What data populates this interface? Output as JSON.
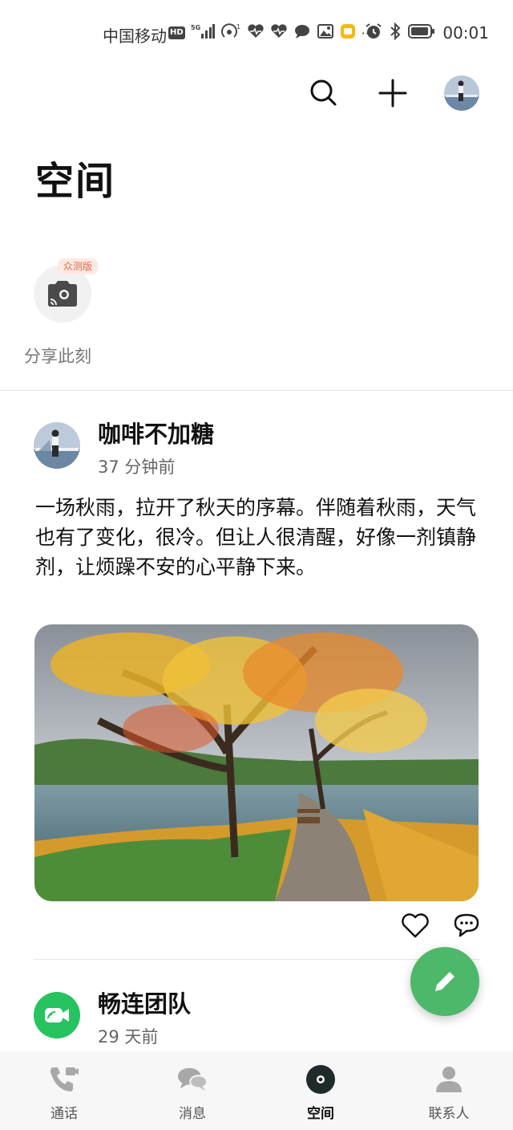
{
  "status_bar": {
    "carrier": "中国移动",
    "hd": "HD",
    "network": "5G",
    "time": "00:01",
    "icons": [
      "signal-icon",
      "hotspot-icon",
      "health-icon",
      "health-icon",
      "chat-icon",
      "gallery-icon",
      "notes-icon",
      "more-icon",
      "alarm-icon",
      "bluetooth-icon",
      "battery-icon"
    ],
    "more": "···"
  },
  "header": {
    "title": "空间",
    "actions": [
      "search-icon",
      "add-icon",
      "avatar"
    ]
  },
  "share": {
    "label": "分享此刻",
    "badge": "众测版"
  },
  "post": {
    "author": "咖啡不加糖",
    "time": "37 分钟前",
    "text": "一场秋雨，拉开了秋天的序幕。伴随着秋雨，天气也有了变化，很冷。但让人很清醒，好像一剂镇静剂，让烦躁不安的心平静下来。"
  },
  "second_item": {
    "name": "畅连团队",
    "time": "29 天前"
  },
  "nav": {
    "items": [
      {
        "label": "通话",
        "icon": "phone-video-icon"
      },
      {
        "label": "消息",
        "icon": "chat-bubbles-icon"
      },
      {
        "label": "空间",
        "icon": "space-icon"
      },
      {
        "label": "联系人",
        "icon": "contacts-icon"
      }
    ],
    "active_index": 2
  },
  "colors": {
    "accent_green": "#4db86a",
    "team_green": "#26c35e",
    "badge_text": "#e06a4f"
  }
}
